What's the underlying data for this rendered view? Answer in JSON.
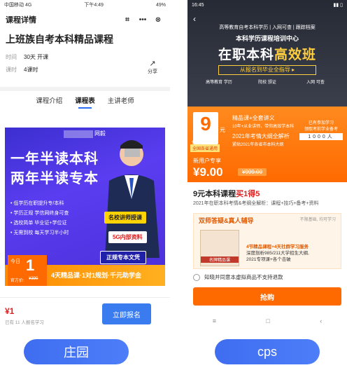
{
  "left_phone": {
    "status": {
      "carrier": "中国移动  4G",
      "time": "下午4:49",
      "battery": "49%"
    },
    "nav": {
      "title": "课程详情"
    },
    "course": {
      "title": "上班族自考本科精品课程",
      "rows": [
        {
          "key": "时间",
          "value": "30天 开课"
        },
        {
          "key": "课时",
          "value": "4课时"
        }
      ],
      "share_label": "分享"
    },
    "tabs": [
      {
        "label": "课程介绍",
        "active": false
      },
      {
        "label": "课程表",
        "active": true
      },
      {
        "label": "主讲老师",
        "active": false
      }
    ],
    "banner": {
      "brand": "网毅",
      "line1": "一年半读本科",
      "line2": "两年半读专本",
      "bullets": [
        "低学历在职提升专/本科",
        "学历正规 学信网终身可查",
        "选校简单 毕业证+学位证",
        "无需到校 每天学习半小时"
      ],
      "tag_teacher": "名校讲师授课",
      "tag_5g": "5G内部资料",
      "tag_text": "正规专本文凭",
      "price_today": "今日",
      "price_value": "1",
      "price_official": "官方价:",
      "price_official_value": "¥399",
      "features": "4天精品课·1对1规划·千元助学金"
    },
    "bottom": {
      "price": "¥1",
      "signed": "已有 11 人报名学习",
      "signup_button": "立即报名"
    }
  },
  "right_phone": {
    "status": {
      "time": "16:45"
    },
    "hero": {
      "small": "高等教育自考本科学历 | 入网可查 | 跟踪档案",
      "org": "本科学历课程培训中心",
      "title_white": "在职本科",
      "title_yellow": "高效班",
      "guide": "从报名到毕业全指导 ▸",
      "laurels": [
        "高等教育\n学历",
        "院校\n颁证",
        "入网\n可查"
      ]
    },
    "promo": {
      "big_price": "9",
      "unit": "元",
      "old_price": "价值 ¥399",
      "badge": "全国各省通用",
      "feature1": "精品课+全套讲义",
      "feature1_sub": "10年+从业讲师，带你高效学本科",
      "feature2": "2021年考情大纲全解析",
      "feature2_sub": "紧贴2021年各省市本科大纲",
      "qr_label": "已有参加学习\n领取考前学业备考",
      "counter": "1000人",
      "new_user": "新用户专享",
      "price": "¥9.00",
      "strike": "¥999.00"
    },
    "product": {
      "title_black": "9元本科课程",
      "title_red": "买1得5",
      "desc": "2021年在职本科考情&考纲全解析：课程+技巧+备考+资料"
    },
    "card": {
      "header": "双师答疑&真人辅导",
      "note": "不限基础, 均可学习",
      "line1": "4节精品课程+4天社群学习服务",
      "line2": "深度剖析985/211大学招生大纲,",
      "line3": "2021专项课+各个击破",
      "book_label": "名牌精品课"
    },
    "agree": "知晓并同意本虚拟商品不支持退款",
    "buy_button": "抢购",
    "navbar": [
      "≡",
      "□",
      "‹"
    ]
  },
  "pills": {
    "left": "庄园",
    "right": "cps"
  }
}
